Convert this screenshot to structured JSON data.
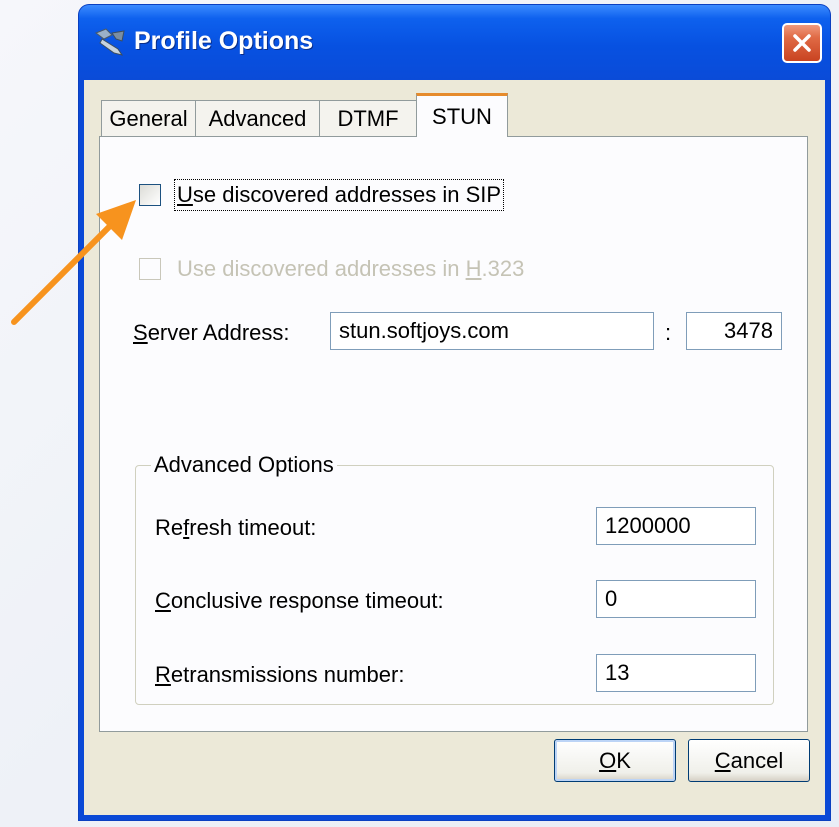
{
  "window": {
    "title": "Profile Options"
  },
  "tabs": [
    {
      "label": "General",
      "active": false
    },
    {
      "label": "Advanced",
      "active": false
    },
    {
      "label": "DTMF",
      "active": false
    },
    {
      "label": "STUN",
      "active": true
    }
  ],
  "stun": {
    "use_sip": {
      "pre": "",
      "key": "U",
      "post": "se discovered addresses in SIP",
      "checked": false,
      "enabled": true
    },
    "use_h323": {
      "pre": "Use discovered addresses in ",
      "key": "H",
      "post": ".323",
      "checked": false,
      "enabled": false
    },
    "server_address": {
      "pre": "",
      "key": "S",
      "post": "erver Address:",
      "value": "stun.softjoys.com",
      "port_separator": ":",
      "port": "3478"
    }
  },
  "advanced_options": {
    "title": "Advanced Options",
    "refresh": {
      "pre": "Re",
      "key": "f",
      "post": "resh timeout:",
      "value": "1200000"
    },
    "conclusive": {
      "pre": "",
      "key": "C",
      "post": "onclusive response timeout:",
      "value": "0"
    },
    "retrans": {
      "pre": "",
      "key": "R",
      "post": "etransmissions number:",
      "value": "13"
    }
  },
  "buttons": {
    "ok": {
      "key": "O",
      "post": "K"
    },
    "cancel": {
      "key": "C",
      "post": "ancel"
    }
  },
  "colors": {
    "titlebar": "#0a4bd8",
    "dialog_bg": "#ece9d8",
    "active_tab_accent": "#e68b2c",
    "annotation_arrow": "#f7931e"
  }
}
